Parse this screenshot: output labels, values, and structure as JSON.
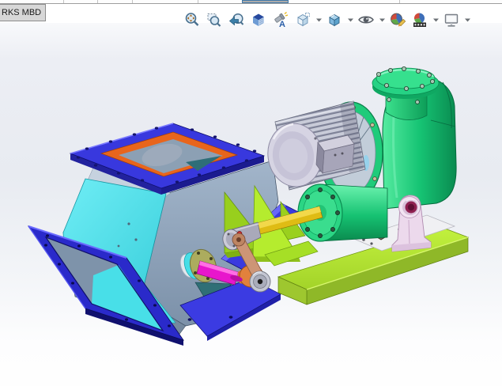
{
  "application": {
    "name": "SOLIDWORKS",
    "module": "MBD"
  },
  "command_tab": {
    "label": "RKS MBD"
  },
  "top_strip": {
    "has_highlighted_button": true
  },
  "heads_up_toolbar": {
    "buttons": [
      {
        "icon": "zoom-to-fit-icon",
        "has_dropdown": false
      },
      {
        "icon": "zoom-to-area-icon",
        "has_dropdown": false
      },
      {
        "icon": "previous-view-icon",
        "has_dropdown": false
      },
      {
        "icon": "section-view-icon",
        "has_dropdown": false
      },
      {
        "icon": "dynamic-annotation-views-icon",
        "has_dropdown": false
      },
      {
        "icon": "view-orientation-icon",
        "has_dropdown": true
      },
      {
        "icon": "display-style-icon",
        "has_dropdown": true
      },
      {
        "icon": "hide-show-items-icon",
        "has_dropdown": true
      },
      {
        "icon": "edit-appearance-icon",
        "has_dropdown": false
      },
      {
        "icon": "apply-scene-icon",
        "has_dropdown": true
      },
      {
        "icon": "view-settings-icon",
        "has_dropdown": true
      }
    ]
  },
  "viewport": {
    "background_top": "#EAEDF3",
    "background_bottom": "#FEFEFE",
    "model": {
      "description": "rotary-valve-feeder-assembly",
      "parts": [
        {
          "name": "inlet-flange",
          "color": "#3838DE"
        },
        {
          "name": "inlet-throat",
          "color": "#E8651C"
        },
        {
          "name": "hopper-body",
          "color": "#8CA1B8"
        },
        {
          "name": "hopper-panel",
          "color": "#4FE3EC"
        },
        {
          "name": "outlet-flange",
          "color": "#2A2ACA"
        },
        {
          "name": "bottom-plate",
          "color": "#3B3BE2"
        },
        {
          "name": "support-plate",
          "color": "#3A3ADF"
        },
        {
          "name": "gusset-brackets",
          "color": "#B5EC2E"
        },
        {
          "name": "base-plate",
          "color": "#B7EA33"
        },
        {
          "name": "mounting-plate",
          "color": "#F0F0F3"
        },
        {
          "name": "drive-housing",
          "color": "#18C878"
        },
        {
          "name": "inspection-cover",
          "color": "#36E08E"
        },
        {
          "name": "bearing-cylinder",
          "color": "#2BD584"
        },
        {
          "name": "electric-motor",
          "color": "#C8CBD8"
        },
        {
          "name": "junction-box",
          "color": "#A7A5B9"
        },
        {
          "name": "drive-shaft",
          "color": "#E3BF15"
        },
        {
          "name": "shaft-coupling",
          "color": "#A9A9BA"
        },
        {
          "name": "set-screw",
          "color": "#D83030"
        },
        {
          "name": "link-arm",
          "color": "#CD9576"
        },
        {
          "name": "eccentric-hub",
          "color": "#E2813C"
        },
        {
          "name": "crank-disc",
          "color": "#C3C6D2"
        },
        {
          "name": "crank-shaft",
          "color": "#E816CC"
        },
        {
          "name": "shaft-flange",
          "color": "#ACAC5E"
        },
        {
          "name": "pedestal-bearing",
          "color": "#ECD9EC"
        },
        {
          "name": "bearing-bore",
          "color": "#8E2050"
        }
      ]
    }
  }
}
